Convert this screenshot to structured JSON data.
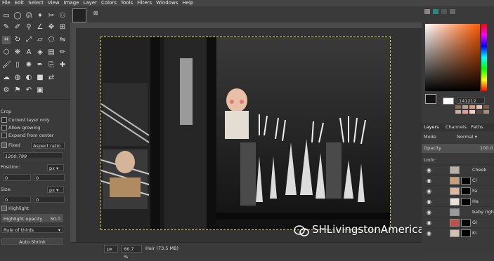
{
  "menu": [
    "File",
    "Edit",
    "Select",
    "View",
    "Image",
    "Layer",
    "Colors",
    "Tools",
    "Filters",
    "Windows",
    "Help"
  ],
  "tool_options": {
    "title": "Crop",
    "current_layer_only": "Current layer only",
    "allow_growing": "Allow growing",
    "expand_from_center": "Expand from center",
    "fixed_label": "Fixed",
    "aspect_ratio": "Aspect ratio",
    "ratio_value": "1200:799",
    "position_label": "Position:",
    "position_unit": "px",
    "position_x": "0",
    "position_y": "0",
    "size_label": "Size:",
    "size_unit": "px",
    "size_w": "0",
    "size_h": "0",
    "highlight_label": "Highlight",
    "highlight_opacity_label": "Highlight opacity",
    "highlight_opacity_value": "50.0",
    "guides_value": "Rule of thirds",
    "auto_shrink": "Auto Shrink"
  },
  "status": {
    "unit": "px",
    "zoom": "66.7 %",
    "layer_info": "Hair (73.5 MB)"
  },
  "right_dock": {
    "hex": "141212",
    "tabs": [
      "Layers",
      "Channels",
      "Paths"
    ],
    "mode_label": "Mode",
    "mode_value": "Normal",
    "opacity_label": "Opacity",
    "opacity_value": "100.0",
    "lock_label": "Lock:",
    "layers": [
      {
        "name": "Cheek",
        "thumb": "#b9b0a8",
        "mask": false
      },
      {
        "name": "Cl",
        "thumb": "#c9a07a",
        "mask": true
      },
      {
        "name": "Fa",
        "thumb": "#e0b8a0",
        "mask": true
      },
      {
        "name": "Ha",
        "thumb": "#e8e2dc",
        "mask": true
      },
      {
        "name": "baby right",
        "thumb": "#9a9a9a",
        "mask": false
      },
      {
        "name": "Gl",
        "thumb": "#c0504a",
        "mask": true
      },
      {
        "name": "Ki",
        "thumb": "#d4c0b0",
        "mask": true
      }
    ]
  },
  "watermark": "SHLivingstonAmericanSchool",
  "colors": {
    "accent_fg": "#141212",
    "swatches": [
      "#8a6e5c",
      "#b9a08c",
      "#d89a8a",
      "#e8c8b8",
      "#7a5a4a",
      "#c8b0a0",
      "#e0a0a0",
      "#f0d0c8",
      "#5a4a40",
      "#a09080"
    ]
  }
}
